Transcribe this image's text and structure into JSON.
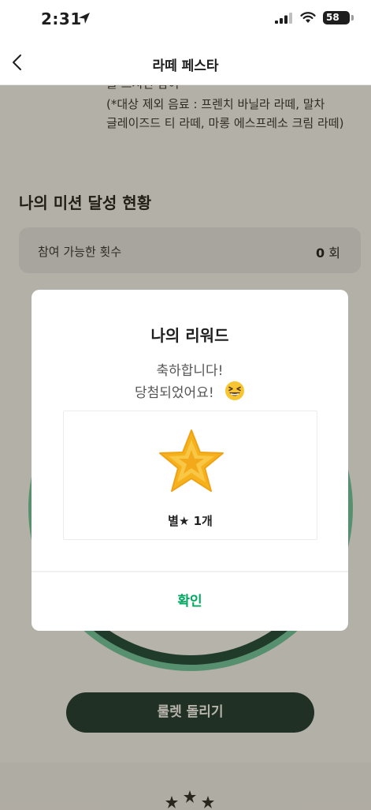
{
  "status_bar": {
    "time": "2:31",
    "battery": "58",
    "icons": [
      "location-arrow-icon",
      "signal-icon",
      "wifi-icon",
      "battery-icon"
    ]
  },
  "nav": {
    "title": "라떼 페스타",
    "back_icon": "chevron-left-icon"
  },
  "content": {
    "description_cut": "를 드시면 참여",
    "description_line1": "(*대상 제외 음료 : 프렌치 바닐라 라떼, 말차",
    "description_line2": "글레이즈드 티 라떼, 마롱 에스프레소 크림 라떼)",
    "mission_heading": "나의 미션 달성 현황",
    "count_label": "참여 가능한 횟수",
    "count_value": "0",
    "count_unit": "회",
    "roulette_button": "룰렛 돌리기"
  },
  "modal": {
    "title": "나의 리워드",
    "message_line1": "축하합니다!",
    "message_line2": "당첨되었어요!",
    "emoji": "grinning-squinting-face-icon",
    "reward_icon": "star-icon",
    "reward_label": "별★ 1개",
    "confirm_label": "확인"
  },
  "colors": {
    "accent_green": "#00a862",
    "dark_green": "#1e3932",
    "overlay": "#bdb49c",
    "star_gold": "#f6b21c"
  }
}
